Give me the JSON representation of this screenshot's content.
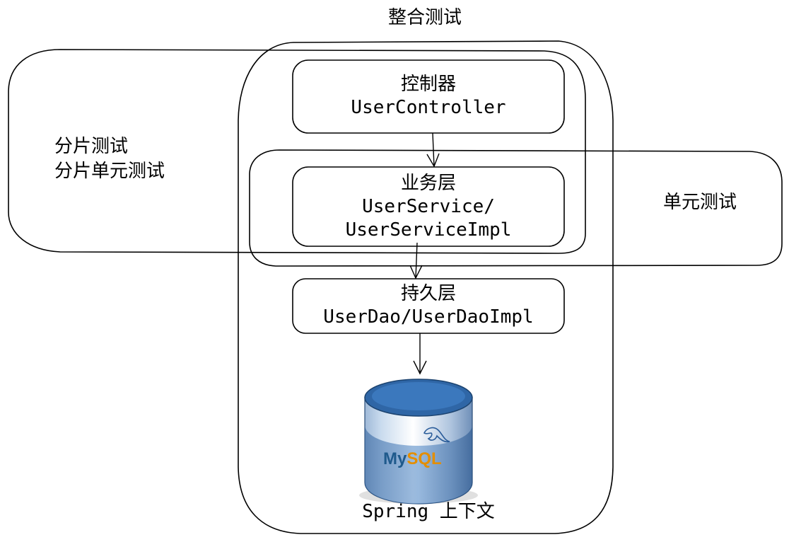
{
  "title": "整合测试",
  "regions": {
    "slice": {
      "line1": "分片测试",
      "line2": "分片单元测试"
    },
    "unit": {
      "label": "单元测试"
    },
    "spring": {
      "label": "Spring 上下文"
    }
  },
  "layers": {
    "controller": {
      "name": "控制器",
      "class1": "UserController"
    },
    "service": {
      "name": "业务层",
      "class1": "UserService/",
      "class2": "UserServiceImpl"
    },
    "persistence": {
      "name": "持久层",
      "class1": "UserDao/UserDaoImpl"
    }
  },
  "database": {
    "logo_text": "MySQL",
    "logo_color_my": "#1f5a8c",
    "logo_color_sql": "#e48e00",
    "icon": "database-cylinder-icon"
  },
  "colors": {
    "stroke": "#000000",
    "db_blue": "#3a6fb0",
    "db_dark": "#1e4f86"
  }
}
